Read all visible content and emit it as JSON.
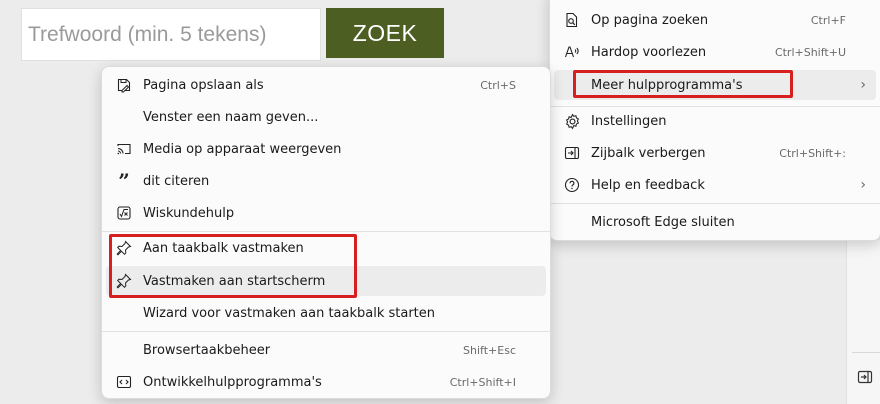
{
  "search": {
    "placeholder": "Trefwoord (min. 5 tekens)",
    "button_label": "ZOEK",
    "button_color": "#4c5e22"
  },
  "main_menu": {
    "items": [
      {
        "label": "Op pagina zoeken",
        "shortcut": "Ctrl+F",
        "icon": "find-in-page-icon"
      },
      {
        "label": "Hardop voorlezen",
        "shortcut": "Ctrl+Shift+U",
        "icon": "read-aloud-icon"
      },
      {
        "label": "Meer hulpprogramma's",
        "shortcut": "",
        "icon": "",
        "has_submenu": true
      },
      {
        "label": "Instellingen",
        "shortcut": "",
        "icon": "gear-icon"
      },
      {
        "label": "Zijbalk verbergen",
        "shortcut": "Ctrl+Shift+:",
        "icon": "sidebar-icon"
      },
      {
        "label": "Help en feedback",
        "shortcut": "",
        "icon": "help-icon",
        "has_submenu": true
      },
      {
        "label": "Microsoft Edge sluiten",
        "shortcut": "",
        "icon": ""
      }
    ]
  },
  "sub_menu": {
    "items": [
      {
        "label": "Pagina opslaan als",
        "shortcut": "Ctrl+S",
        "icon": "save-page-icon"
      },
      {
        "label": "Venster een naam geven...",
        "shortcut": "",
        "icon": ""
      },
      {
        "label": "Media op apparaat weergeven",
        "shortcut": "",
        "icon": "cast-icon"
      },
      {
        "label": "dit citeren",
        "shortcut": "",
        "icon": "quote-icon"
      },
      {
        "label": "Wiskundehulp",
        "shortcut": "",
        "icon": "math-solver-icon"
      },
      {
        "label": "Aan taakbalk vastmaken",
        "shortcut": "",
        "icon": "pin-icon"
      },
      {
        "label": "Vastmaken aan startscherm",
        "shortcut": "",
        "icon": "pin-icon"
      },
      {
        "label": "Wizard voor vastmaken aan taakbalk starten",
        "shortcut": "",
        "icon": ""
      },
      {
        "label": "Browsertaakbeheer",
        "shortcut": "Shift+Esc",
        "icon": ""
      },
      {
        "label": "Ontwikkelhulpprogramma's",
        "shortcut": "Ctrl+Shift+I",
        "icon": "developer-tools-icon"
      }
    ]
  },
  "annotation_color": "#d81f1f"
}
